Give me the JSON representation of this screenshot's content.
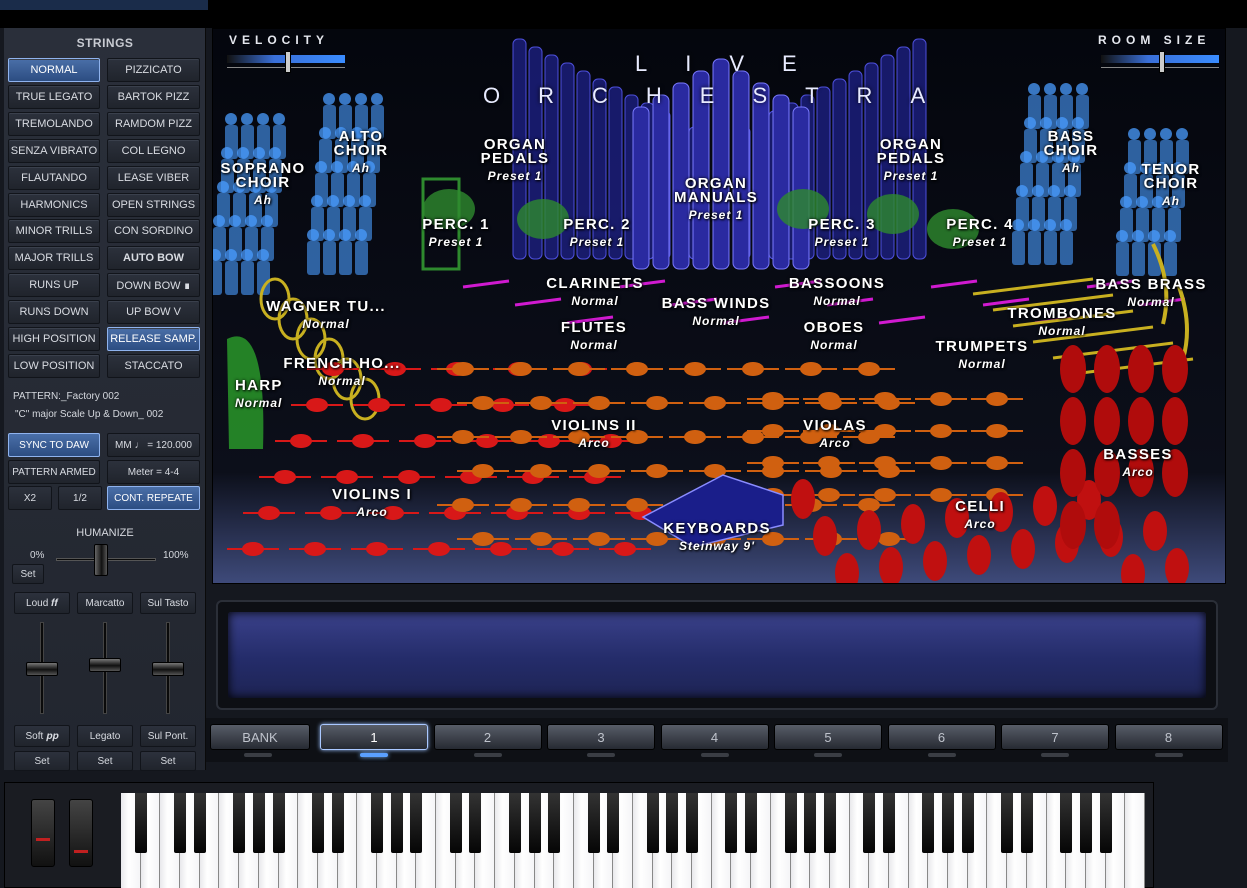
{
  "colors": {
    "accent": "#4a6fa8",
    "strings_red": "#d81818",
    "strings_orange": "#d06010",
    "brass": "#c8b020",
    "choir": "#4a9cff",
    "organ": "#3b3bd0",
    "perc": "#2e8a2e",
    "winds": "#d01ad0"
  },
  "left": {
    "title": "STRINGS",
    "articulations": [
      [
        "NORMAL",
        "PIZZICATO"
      ],
      [
        "TRUE LEGATO",
        "BARTOK PIZZ"
      ],
      [
        "TREMOLANDO",
        "RAMDOM PIZZ"
      ],
      [
        "SENZA VIBRATO",
        "COL LEGNO"
      ],
      [
        "FLAUTANDO",
        "LEASE VIBER"
      ],
      [
        "HARMONICS",
        "OPEN STRINGS"
      ],
      [
        "MINOR TRILLS",
        "CON SORDINO"
      ],
      [
        "MAJOR TRILLS",
        "AUTO BOW"
      ],
      [
        "RUNS UP",
        "DOWN BOW ∎"
      ],
      [
        "RUNS DOWN",
        "UP BOW  V"
      ],
      [
        "HIGH POSITION",
        "RELEASE  SAMP."
      ],
      [
        "LOW POSITION",
        "STACCATO"
      ]
    ],
    "pattern": "PATTERN:_Factory  002",
    "pattern_desc": "\"C\" major Scale Up & Down_ 002",
    "sync": "SYNC TO DAW",
    "tempo": "MM ♩ = 120.000",
    "armed": "PATTERN ARMED",
    "meter": "Meter = 4-4",
    "x2": "X2",
    "half": "1/2",
    "cont": "CONT. REPEATE",
    "humanize": "HUMANIZE",
    "hum_min": "0%",
    "hum_max": "100%",
    "hum_set": "Set",
    "faders": [
      {
        "top": "Loud  𝒇𝒇",
        "bottom": "Soft  𝒑𝒑",
        "set": "Set"
      },
      {
        "top": "Marcatto",
        "bottom": "Legato",
        "set": "Set"
      },
      {
        "top": "Sul Tasto",
        "bottom": "Sul Pont.",
        "set": "Set"
      }
    ]
  },
  "stage": {
    "title_top": "LIVE",
    "title_bottom": "ORCHESTRA",
    "velocity": "VELOCITY",
    "room": "ROOM SIZE",
    "sections": [
      {
        "n": "SOPRANO\nCHOIR",
        "s": "Ah"
      },
      {
        "n": "ALTO\nCHOIR",
        "s": "Ah"
      },
      {
        "n": "ORGAN\nPEDALS",
        "s": "Preset 1"
      },
      {
        "n": "ORGAN\nMANUALS",
        "s": "Preset 1"
      },
      {
        "n": "ORGAN\nPEDALS",
        "s": "Preset 1"
      },
      {
        "n": "BASS\nCHOIR",
        "s": "Ah"
      },
      {
        "n": "TENOR\nCHOIR",
        "s": "Ah"
      },
      {
        "n": "PERC. 1",
        "s": "Preset 1"
      },
      {
        "n": "PERC. 2",
        "s": "Preset 1"
      },
      {
        "n": "PERC. 3",
        "s": "Preset 1"
      },
      {
        "n": "PERC. 4",
        "s": "Preset 1"
      },
      {
        "n": "CLARINETS",
        "s": "Normal"
      },
      {
        "n": "BASSOONS",
        "s": "Normal"
      },
      {
        "n": "BASS WINDS",
        "s": "Normal"
      },
      {
        "n": "FLUTES",
        "s": "Normal"
      },
      {
        "n": "OBOES",
        "s": "Normal"
      },
      {
        "n": "WAGNER TU...",
        "s": "Normal"
      },
      {
        "n": "FRENCH HO...",
        "s": "Normal"
      },
      {
        "n": "HARP",
        "s": "Normal"
      },
      {
        "n": "BASS BRASS",
        "s": "Normal"
      },
      {
        "n": "TROMBONES",
        "s": "Normal"
      },
      {
        "n": "TRUMPETS",
        "s": "Normal"
      },
      {
        "n": "VIOLINS II",
        "s": "Arco"
      },
      {
        "n": "VIOLAS",
        "s": "Arco"
      },
      {
        "n": "VIOLINS I",
        "s": "Arco"
      },
      {
        "n": "KEYBOARDS",
        "s": "Steinway 9'"
      },
      {
        "n": "CELLI",
        "s": "Arco"
      },
      {
        "n": "BASSES",
        "s": "Arco"
      }
    ]
  },
  "banks": {
    "bank": "BANK",
    "items": [
      "1",
      "2",
      "3",
      "4",
      "5",
      "6",
      "7",
      "8"
    ],
    "selected": "1"
  }
}
